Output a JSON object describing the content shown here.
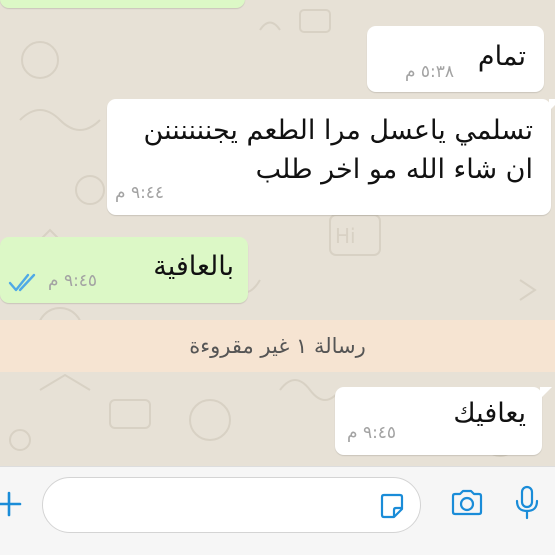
{
  "theme": {
    "accent": "#1a8cd8",
    "incoming_bubble": "#ffffff",
    "outgoing_bubble": "#dcf8c6",
    "read_tick_color": "#4fa9e6",
    "unread_banner_bg": "#f6e4d2"
  },
  "messages": [
    {
      "direction": "incoming",
      "text": "تمام",
      "time": "٥:٣٨ م"
    },
    {
      "direction": "incoming",
      "lines": [
        "تسلمي ياعسل مرا الطعم يجننننننن",
        "ان شاء الله مو اخر طلب"
      ],
      "time": "٩:٤٤ م"
    },
    {
      "direction": "outgoing",
      "text": "بالعافية",
      "time": "٩:٤٥ م",
      "status": "read"
    },
    {
      "direction": "incoming",
      "text": "يعافيك",
      "time": "٩:٤٥ م"
    }
  ],
  "unread_banner": {
    "text": "رسالة ١ غير مقروءة"
  },
  "input_bar": {
    "message_placeholder": "",
    "icons": [
      "plus-icon",
      "sticker-icon",
      "camera-icon",
      "microphone-icon"
    ]
  }
}
